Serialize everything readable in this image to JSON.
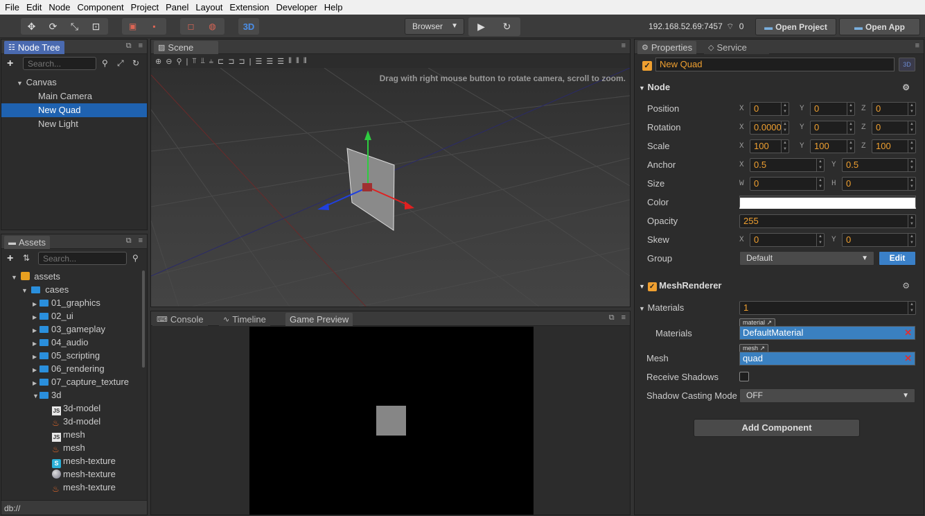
{
  "menu": [
    "File",
    "Edit",
    "Node",
    "Component",
    "Project",
    "Panel",
    "Layout",
    "Extension",
    "Developer",
    "Help"
  ],
  "toolbar": {
    "mode_3d": "3D",
    "platform": "Browser",
    "ip": "192.168.52.69:7457",
    "connections": "0",
    "open_project": "Open Project",
    "open_app": "Open App"
  },
  "node_tree": {
    "tab": "Node Tree",
    "search_placeholder": "Search...",
    "items": [
      {
        "label": "Canvas",
        "level": 0,
        "expanded": true,
        "selected": false
      },
      {
        "label": "Main Camera",
        "level": 1,
        "selected": false
      },
      {
        "label": "New Quad",
        "level": 1,
        "selected": true
      },
      {
        "label": "New Light",
        "level": 1,
        "selected": false
      }
    ]
  },
  "scene": {
    "tab": "Scene",
    "hint": "Drag with right mouse button to rotate camera, scroll to zoom."
  },
  "assets": {
    "tab": "Assets",
    "search_placeholder": "Search...",
    "root": "assets",
    "cases": "cases",
    "folders": [
      "01_graphics",
      "02_ui",
      "03_gameplay",
      "04_audio",
      "05_scripting",
      "06_rendering",
      "07_capture_texture"
    ],
    "open_folder": "3d",
    "files": [
      {
        "icon": "js",
        "label": "3d-model"
      },
      {
        "icon": "fire",
        "label": "3d-model"
      },
      {
        "icon": "js",
        "label": "mesh"
      },
      {
        "icon": "fire",
        "label": "mesh"
      },
      {
        "icon": "s",
        "label": "mesh-texture"
      },
      {
        "icon": "ball",
        "label": "mesh-texture"
      },
      {
        "icon": "fire",
        "label": "mesh-texture"
      }
    ],
    "footer": "db://"
  },
  "bottom_tabs": [
    "Console",
    "Timeline",
    "Game Preview"
  ],
  "properties": {
    "tabs": [
      "Properties",
      "Service"
    ],
    "node_name": "New Quad",
    "badge_3d": "3D",
    "node_section": "Node",
    "position": {
      "label": "Position",
      "x": "0",
      "y": "0",
      "z": "0"
    },
    "rotation": {
      "label": "Rotation",
      "x": "0.0000",
      "y": "0",
      "z": "0"
    },
    "scale": {
      "label": "Scale",
      "x": "100",
      "y": "100",
      "z": "100"
    },
    "anchor": {
      "label": "Anchor",
      "x": "0.5",
      "y": "0.5"
    },
    "size": {
      "label": "Size",
      "w": "0",
      "h": "0"
    },
    "color": {
      "label": "Color",
      "value": "#ffffff"
    },
    "opacity": {
      "label": "Opacity",
      "value": "255"
    },
    "skew": {
      "label": "Skew",
      "x": "0",
      "y": "0"
    },
    "group": {
      "label": "Group",
      "value": "Default",
      "edit": "Edit"
    },
    "mesh_renderer": "MeshRenderer",
    "materials_count_label": "Materials",
    "materials_count": "1",
    "materials_label": "Materials",
    "material_tag": "material",
    "material_value": "DefaultMaterial",
    "mesh_label": "Mesh",
    "mesh_tag": "mesh",
    "mesh_value": "quad",
    "receive_shadows": "Receive Shadows",
    "shadow_mode_label": "Shadow Casting Mode",
    "shadow_mode_value": "OFF",
    "add_component": "Add Component"
  },
  "axes": {
    "x": "X",
    "y": "Y",
    "z": "Z",
    "w": "W",
    "h": "H"
  },
  "colors": {
    "accent": "#f0a030",
    "selection": "#1f62b0",
    "tab_active": "#4a6ab0"
  }
}
